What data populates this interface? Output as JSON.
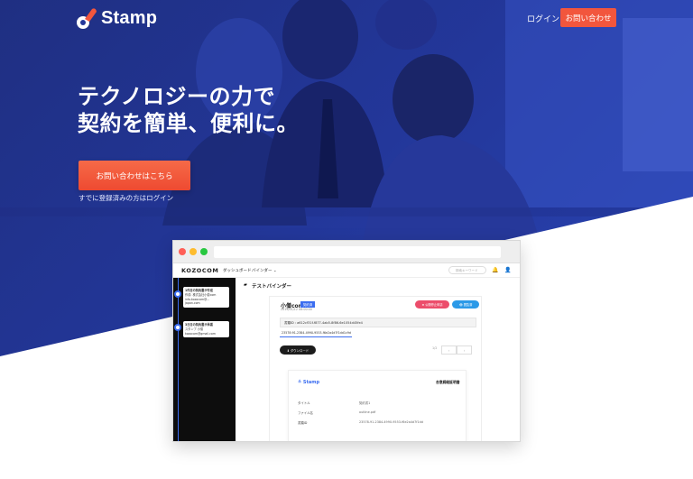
{
  "header": {
    "logo_text": "Stamp",
    "login_label": "ログイン",
    "contact_label": "お問い合わせ"
  },
  "hero": {
    "headline_line1": "テクノロジーの力で",
    "headline_line2": "契約を簡単、便利に。",
    "cta_label": "お問い合わせはこちら",
    "login_note": "すでに登録済みの方はログイン"
  },
  "mockup": {
    "app_logo": "KOZOCOM",
    "nav": [
      "ダッシュボード",
      "バインダー ⌄"
    ],
    "search_placeholder": "検索キーワード",
    "timeline": [
      {
        "title": "1件目の契約書が作成",
        "lines": [
          "作成: 株式会社小僧com",
          "info.kozocom@...",
          "japan.com"
        ]
      },
      {
        "title": "3日目の契約書が承認",
        "lines": [
          "スタンプ  小僧",
          "kozocom@gmail.com"
        ]
      }
    ],
    "binder_title": "テストバインダー",
    "doc": {
      "title": "小僧com",
      "badge": "契約済",
      "subtitle": "2019/01/12 08:00:00",
      "action_red": "⊕ 公開停止申請",
      "action_blue": "👁 閲覧済",
      "doc_id": "書類ID : a612cf31f-f877-4ab5-8f86-6e1054d45fe4",
      "hash": "23578:91-2384-4990-9553-f6e2a4d7f1dd1c9d",
      "download_label": "⬇ ダウンロード",
      "pager_text": "1/2",
      "paper_logo": "≗ Stamp",
      "paper_title": "合意締結証明書",
      "rows": [
        {
          "label": "タイトル",
          "value": "契約書1"
        },
        {
          "label": "ファイル名",
          "value": "outline.pdf"
        },
        {
          "label": "書類ID",
          "value": "23578-91-2384-4990-9553-f6e2a4d7f1dd"
        }
      ]
    }
  },
  "colors": {
    "hero_blue": "#23379a",
    "accent_orange": "#f2563d",
    "timeline_blue": "#3b6df0"
  }
}
